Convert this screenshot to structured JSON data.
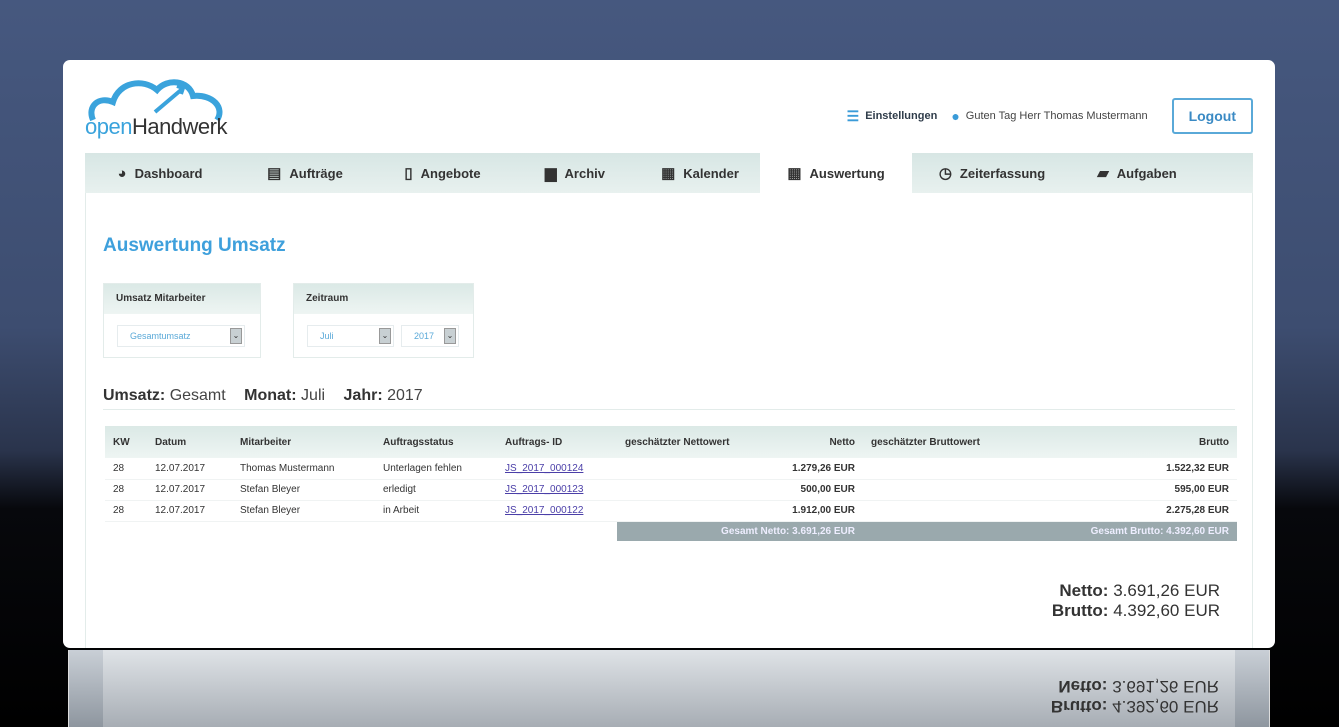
{
  "logo": {
    "part1": "open",
    "part2": "Handwerk"
  },
  "header": {
    "settings": "Einstellungen",
    "greeting": "Guten Tag Herr Thomas Mustermann",
    "logout": "Logout"
  },
  "tabs": [
    {
      "label": "Dashboard",
      "icon": "dashboard-icon"
    },
    {
      "label": "Aufträge",
      "icon": "document-icon"
    },
    {
      "label": "Angebote",
      "icon": "file-icon"
    },
    {
      "label": "Archiv",
      "icon": "archive-icon"
    },
    {
      "label": "Kalender",
      "icon": "calendar-icon"
    },
    {
      "label": "Auswertung",
      "icon": "calculator-icon",
      "active": true
    },
    {
      "label": "Zeiterfassung",
      "icon": "clock-icon"
    },
    {
      "label": "Aufgaben",
      "icon": "book-icon"
    }
  ],
  "page": {
    "title": "Auswertung Umsatz"
  },
  "filters": {
    "employee_label": "Umsatz Mitarbeiter",
    "employee_value": "Gesamtumsatz",
    "period_label": "Zeitraum",
    "month_value": "Juli",
    "year_value": "2017"
  },
  "summary": {
    "umsatz_label": "Umsatz:",
    "umsatz": "Gesamt",
    "monat_label": "Monat:",
    "monat": "Juli",
    "jahr_label": "Jahr:",
    "jahr": "2017"
  },
  "table": {
    "headers": [
      "KW",
      "Datum",
      "Mitarbeiter",
      "Auftragsstatus",
      "Auftrags- ID",
      "geschätzter Nettowert",
      "Netto",
      "geschätzter Bruttowert",
      "Brutto"
    ],
    "rows": [
      [
        "28",
        "12.07.2017",
        "Thomas Mustermann",
        "Unterlagen fehlen",
        "JS_2017_000124",
        "",
        "1.279,26 EUR",
        "",
        "1.522,32 EUR"
      ],
      [
        "28",
        "12.07.2017",
        "Stefan Bleyer",
        "erledigt",
        "JS_2017_000123",
        "",
        "500,00 EUR",
        "",
        "595,00 EUR"
      ],
      [
        "28",
        "12.07.2017",
        "Stefan Bleyer",
        "in Arbeit",
        "JS_2017_000122",
        "",
        "1.912,00 EUR",
        "",
        "2.275,28 EUR"
      ]
    ],
    "total_netto": "Gesamt Netto: 3.691,26 EUR",
    "total_brutto": "Gesamt Brutto: 4.392,60 EUR"
  },
  "totals": {
    "netto_label": "Netto:",
    "netto": "3.691,26 EUR",
    "brutto_label": "Brutto:",
    "brutto": "4.392,60 EUR"
  }
}
